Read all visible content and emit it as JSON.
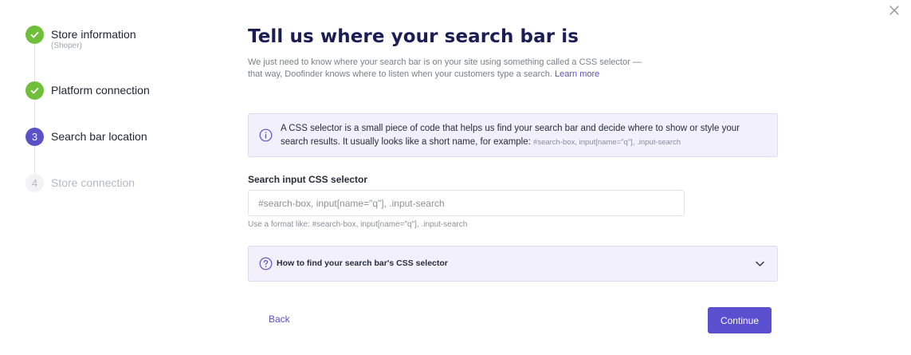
{
  "window": {
    "close_icon": "close-icon"
  },
  "stepper": {
    "steps": [
      {
        "number": "",
        "label": "Store information",
        "sublabel": "(Shoper)",
        "state": "completed",
        "icon": "check-icon"
      },
      {
        "number": "",
        "label": "Platform connection",
        "sublabel": "",
        "state": "completed",
        "icon": "check-icon"
      },
      {
        "number": "3",
        "label": "Search bar location",
        "sublabel": "",
        "state": "active"
      },
      {
        "number": "4",
        "label": "Store connection",
        "sublabel": "",
        "state": "pending"
      }
    ]
  },
  "main": {
    "title": "Tell us where your search bar is",
    "description_line1": "We just need to know where your search bar is on your site using something called a CSS selector —",
    "description_line2": "that way, Doofinder knows where to listen when your customers type a search.",
    "learn_more": "Learn more",
    "info": {
      "icon": "info-icon",
      "text": "A CSS selector is a small piece of code that helps us find your search bar and decide where to show or style your search results. It usually looks like a short name, for example:",
      "example": "#search-box, input[name=\"q\"], .input-search"
    },
    "field": {
      "label": "Search input CSS selector",
      "placeholder": "#search-box, input[name=\"q\"], .input-search",
      "value": "",
      "helper": "Use a format like: #search-box, input[name=\"q\"], .input-search"
    },
    "accordion": {
      "icon": "help-circle-icon",
      "label": "How to find your search bar's CSS selector",
      "chevron": "chevron-down-icon",
      "expanded": false
    },
    "actions": {
      "back_label": "Back",
      "continue_label": "Continue"
    }
  },
  "colors": {
    "accent": "#5a4fcf",
    "success": "#6fbf3a",
    "title": "#1b1d56",
    "info_background": "#f1f0fc"
  }
}
